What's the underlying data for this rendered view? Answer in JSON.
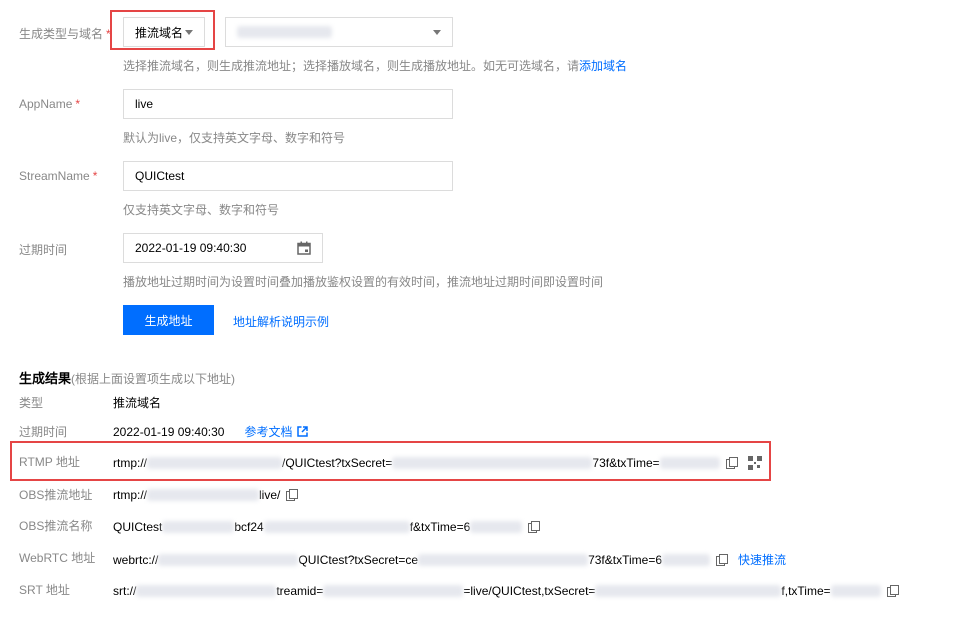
{
  "form": {
    "type_domain": {
      "label": "生成类型与域名",
      "required_mark": "*",
      "type_value": "推流域名",
      "hint_prefix": "选择推流域名，则生成推流地址；选择播放域名，则生成播放地址。如无可选域名，请",
      "hint_link": "添加域名"
    },
    "app_name": {
      "label": "AppName",
      "required_mark": "*",
      "value": "live",
      "hint": "默认为live，仅支持英文字母、数字和符号"
    },
    "stream_name": {
      "label": "StreamName",
      "required_mark": "*",
      "value": "QUICtest",
      "hint": "仅支持英文字母、数字和符号"
    },
    "expire": {
      "label": "过期时间",
      "value": "2022-01-19 09:40:30",
      "hint": "播放地址过期时间为设置时间叠加播放鉴权设置的有效时间，推流地址过期时间即设置时间"
    },
    "generate_button": "生成地址",
    "explain_link": "地址解析说明示例"
  },
  "result": {
    "title": "生成结果",
    "subtitle": "(根据上面设置项生成以下地址)",
    "type_label": "类型",
    "type_value": "推流域名",
    "expire_label": "过期时间",
    "expire_value": "2022-01-19 09:40:30",
    "doc_link": "参考文档",
    "rtmp": {
      "label": "RTMP 地址",
      "p1": "rtmp://",
      "p2": "/QUICtest?txSecret=",
      "p3": "73f&txTime="
    },
    "obs_addr": {
      "label": "OBS推流地址",
      "p1": "rtmp://",
      "p2": "live/"
    },
    "obs_name": {
      "label": "OBS推流名称",
      "p1": "QUICtest",
      "p2": "bcf24",
      "p3": "f&txTime=6"
    },
    "webrtc": {
      "label": "WebRTC 地址",
      "p1": "webrtc://",
      "p2": "QUICtest?txSecret=ce",
      "p3": "73f&txTime=6",
      "link": "快速推流"
    },
    "srt": {
      "label": "SRT 地址",
      "p1": "srt://",
      "p2": "treamid=",
      "p3": "=live/QUICtest,txSecret=",
      "p4": "f,txTime="
    }
  },
  "colors": {
    "accent": "#006eff",
    "highlight": "#e54545"
  }
}
